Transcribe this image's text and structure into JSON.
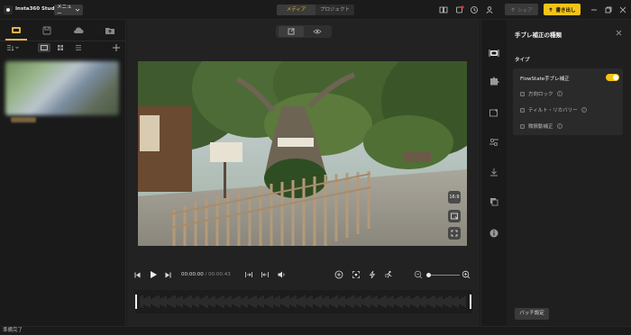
{
  "app": {
    "title": "Insta360 Studio",
    "menu_label": "メニュー"
  },
  "modes": [
    {
      "label": "メディア",
      "active": true
    },
    {
      "label": "プロジェクト",
      "active": false
    }
  ],
  "topbar": {
    "share_label": "シェア",
    "export_label": "書き出し"
  },
  "icons": {
    "top": [
      "book-icon",
      "notification-icon",
      "refresh-icon",
      "user-icon",
      "minimize-icon",
      "restore-icon",
      "close-icon"
    ],
    "left_tabs": [
      "local-media-icon",
      "folder-icon",
      "cloud-icon",
      "upload-folder-icon"
    ],
    "right_tools": [
      "stabilization-icon",
      "puzzle-icon",
      "enhance-icon",
      "color-tune-icon",
      "download-icon",
      "layers-icon",
      "info-icon"
    ]
  },
  "player": {
    "current_time": "00:00:00",
    "total_time": "00:00:43",
    "aspect_ratio": "16:9"
  },
  "stabilization": {
    "title": "手ブレ補正の種類",
    "type_label": "タイプ",
    "flowstate_label": "FlowState手ブレ補正",
    "flowstate_on": true,
    "options": [
      {
        "label": "方向ロック",
        "checked": false
      },
      {
        "label": "ティルト・リカバリー",
        "checked": false
      },
      {
        "label": "微振動補正",
        "checked": false
      }
    ],
    "batch_label": "バッチ設定"
  },
  "status_text": "準備完了",
  "colors": {
    "accent": "#f5c316",
    "accent_text": "#e0b44a"
  }
}
